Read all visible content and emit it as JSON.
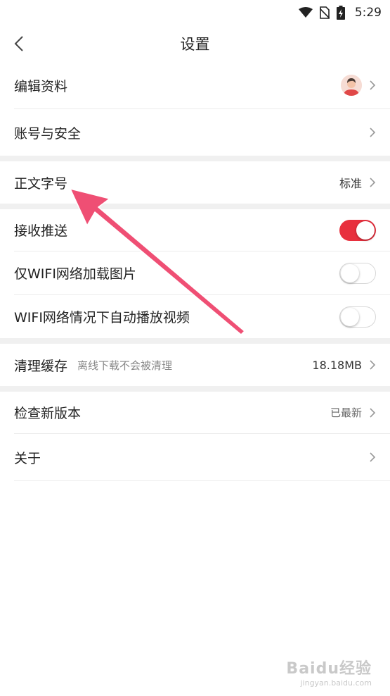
{
  "status_bar": {
    "time": "5:29",
    "icons": [
      "wifi-icon",
      "no-sim-icon",
      "battery-charging-icon"
    ]
  },
  "header": {
    "title": "设置",
    "back_icon": "chevron-left-icon"
  },
  "settings": {
    "edit_profile": {
      "label": "编辑资料",
      "icon": "avatar-icon"
    },
    "account_security": {
      "label": "账号与安全"
    },
    "font_size": {
      "label": "正文字号",
      "value": "标准"
    },
    "push": {
      "label": "接收推送",
      "enabled": true
    },
    "wifi_images": {
      "label": "仅WIFI网络加载图片",
      "enabled": false
    },
    "wifi_autoplay": {
      "label": "WIFI网络情况下自动播放视频",
      "enabled": false
    },
    "clear_cache": {
      "label": "清理缓存",
      "hint": "离线下载不会被清理",
      "value": "18.18MB"
    },
    "check_update": {
      "label": "检查新版本",
      "value": "已最新"
    },
    "about": {
      "label": "关于"
    }
  },
  "watermark": {
    "text": "Baidu经验",
    "sub": "jingyan.baidu.com"
  },
  "colors": {
    "accent": "#e8303e",
    "annotation_arrow": "#ef4f74"
  }
}
